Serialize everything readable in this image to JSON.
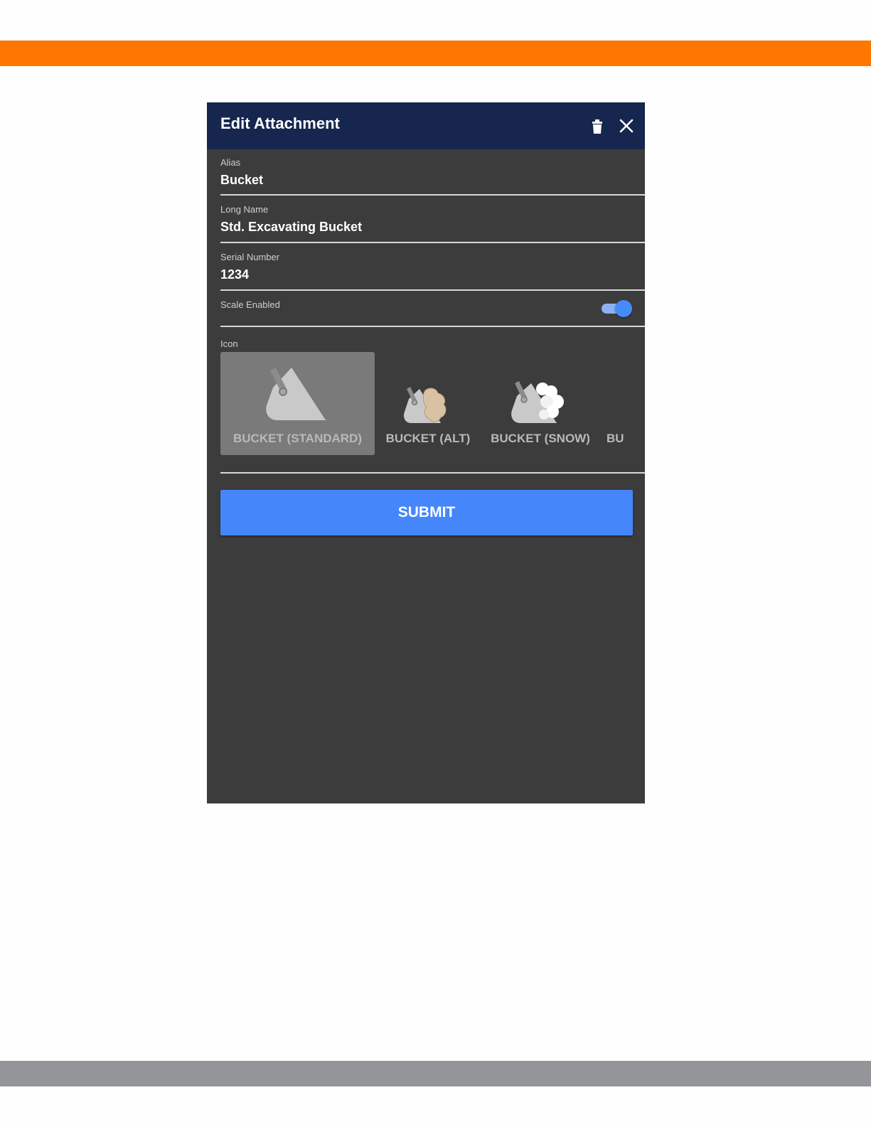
{
  "dialog": {
    "title": "Edit Attachment"
  },
  "fields": {
    "alias": {
      "label": "Alias",
      "value": "Bucket"
    },
    "long_name": {
      "label": "Long Name",
      "value": "Std. Excavating Bucket"
    },
    "serial_number": {
      "label": "Serial Number",
      "value": "1234"
    },
    "scale_enabled": {
      "label": "Scale Enabled",
      "on": true
    }
  },
  "icon_picker": {
    "label": "Icon",
    "options": [
      {
        "label": "BUCKET (STANDARD)",
        "selected": true
      },
      {
        "label": "BUCKET (ALT)",
        "selected": false
      },
      {
        "label": "BUCKET (SNOW)",
        "selected": false
      },
      {
        "label": "BU",
        "selected": false
      }
    ]
  },
  "submit_label": "SUBMIT",
  "colors": {
    "accent_orange": "#ff7603",
    "header_navy": "#16264f",
    "panel_bg": "#3c3c3c",
    "primary_blue": "#4587fb",
    "footer_gray": "#939598"
  },
  "icons": {
    "delete": "trash-icon",
    "close": "close-icon"
  }
}
